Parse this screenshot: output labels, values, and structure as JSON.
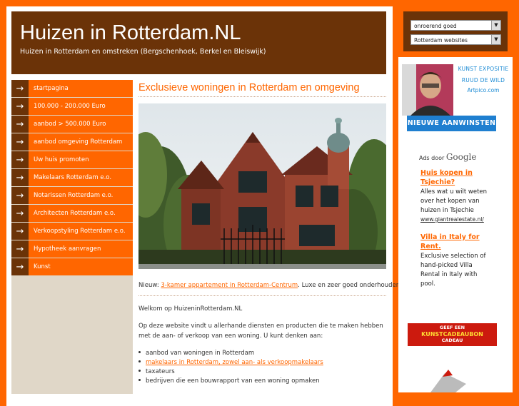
{
  "header": {
    "title": "Huizen in Rotterdam.NL",
    "subtitle": "Huizen in Rotterdam en omstreken (Bergschenhoek, Berkel en Bleiswijk)"
  },
  "nav": {
    "items": [
      {
        "label": "startpagina"
      },
      {
        "label": "100.000 - 200.000 Euro"
      },
      {
        "label": "aanbod > 500.000 Euro"
      },
      {
        "label": "aanbod omgeving Rotterdam"
      },
      {
        "label": "Uw huis promoten"
      },
      {
        "label": "Makelaars Rotterdam e.o."
      },
      {
        "label": "Notarissen Rotterdam e.o."
      },
      {
        "label": "Architecten Rotterdam e.o."
      },
      {
        "label": "Verkoopstyling Rotterdam e.o."
      },
      {
        "label": "Hypotheek aanvragen"
      },
      {
        "label": "Kunst"
      }
    ]
  },
  "main": {
    "title": "Exclusieve woningen in Rotterdam en omgeving",
    "news_prefix": "Nieuw: ",
    "news_link": "3-kamer appartement in Rotterdam-Centrum",
    "news_suffix": ". Luxe en zeer goed onderhouden.",
    "welcome": "Welkom op HuizeninRotterdam.NL",
    "intro": "Op deze website vindt u allerhande diensten en producten die te maken hebben met de aan- of verkoop van een woning. U kunt denken aan:",
    "bullets": [
      {
        "text": "aanbod van woningen in Rotterdam",
        "link": false
      },
      {
        "text": "makelaars in Rotterdam, zowel aan- als verkoopmakelaars",
        "link": true
      },
      {
        "text": "taxateurs",
        "link": false
      },
      {
        "text": "bedrijven die een bouwrapport van een woning opmaken",
        "link": false
      }
    ]
  },
  "right": {
    "select1": "onroerend goed",
    "select2": "Rotterdam websites",
    "artist_line1": "KUNST EXPOSITIE",
    "artist_line2": "RUUD DE WILD",
    "artist_line3": "Artpico.com",
    "new_banner": "NIEUWE AANWINSTEN",
    "ads_by": "Ads door",
    "ads_brand": "Google",
    "ads": [
      {
        "title": "Huis kopen in Tsjechie?",
        "desc": "Alles wat u wilt weten over het kopen van huizen in Tsjechie",
        "url": "www.giantrealestate.nl/"
      },
      {
        "title": "Villa in Italy for Rent.",
        "desc": "Exclusive selection of hand-picked Villa Rental in Italy with pool.",
        "url": ""
      }
    ],
    "gift_line1": "GEEF EEN",
    "gift_line2": "KUNSTCADEAUBON",
    "gift_line3": "CADEAU"
  },
  "colors": {
    "orange": "#ff6600",
    "brown": "#6b3308",
    "blue": "#1f7fd0"
  }
}
